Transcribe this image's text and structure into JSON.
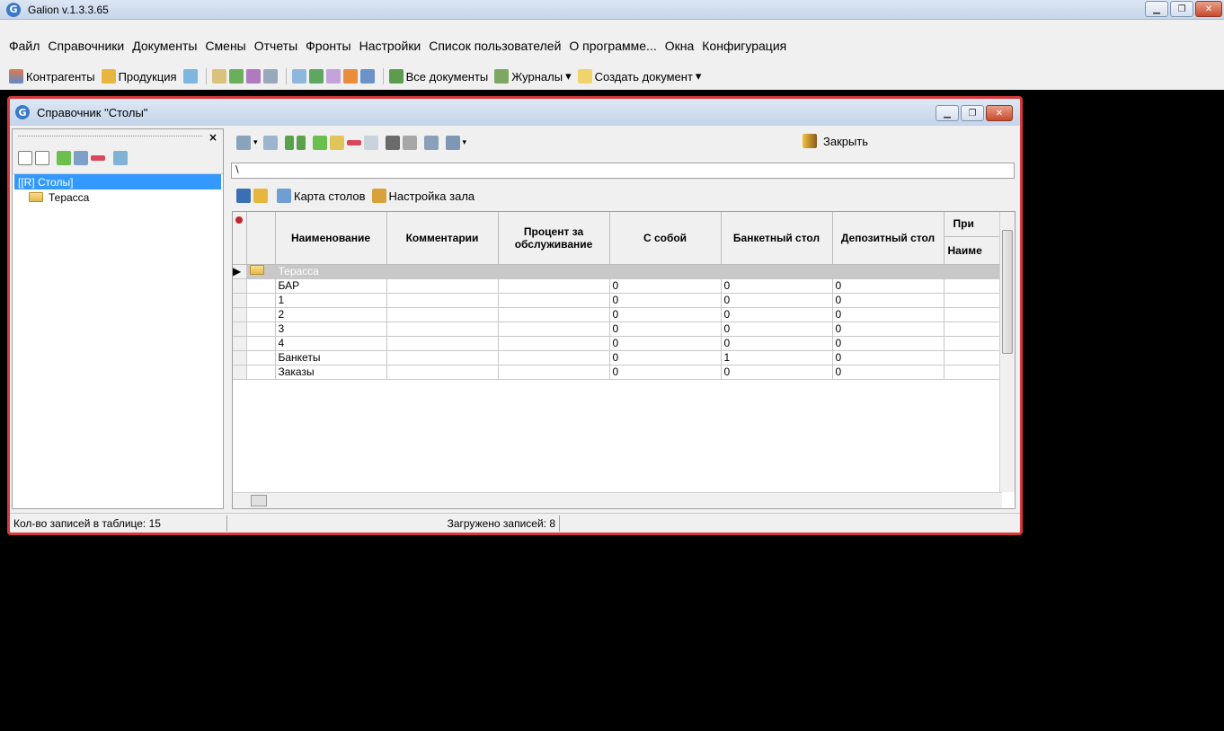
{
  "app": {
    "title": "Galion v.1.3.3.65",
    "logo_glyph": "G"
  },
  "window_buttons": {
    "minimize": "▁",
    "restore": "❐",
    "close": "✕"
  },
  "menu": {
    "items": [
      "Файл",
      "Справочники",
      "Документы",
      "Смены",
      "Отчеты",
      "Фронты",
      "Настройки",
      "Список пользователей",
      "О программе...",
      "Окна",
      "Конфигурация"
    ]
  },
  "toolbar": {
    "contractors": "Контрагенты",
    "products": "Продукция",
    "all_documents": "Все документы",
    "journals": "Журналы",
    "create_document": "Создать документ",
    "dropdown_glyph": "▾"
  },
  "child_window": {
    "title": "Справочник \"Столы\"",
    "close_pane_glyph": "×"
  },
  "tree": {
    "items": [
      {
        "label": "[[R] Столы]",
        "selected": true
      },
      {
        "label": "Терасса",
        "selected": false
      }
    ]
  },
  "grid_toolbar": {
    "close_label": "Закрыть",
    "tables_map": "Карта столов",
    "hall_settings": "Настройка зала",
    "path": "\\"
  },
  "grid": {
    "columns": [
      "Наименование",
      "Комментарии",
      "Процент за обслуживание",
      "С собой",
      "Банкетный стол",
      "Депозитный стол"
    ],
    "extra_column_top": "При",
    "extra_column_bottom": "Наиме",
    "group_row": "Терасса",
    "rows": [
      {
        "name": "БАР",
        "comment": "",
        "service": "",
        "takeaway": "0",
        "banquet": "0",
        "deposit": "0"
      },
      {
        "name": "1",
        "comment": "",
        "service": "",
        "takeaway": "0",
        "banquet": "0",
        "deposit": "0"
      },
      {
        "name": "2",
        "comment": "",
        "service": "",
        "takeaway": "0",
        "banquet": "0",
        "deposit": "0"
      },
      {
        "name": "3",
        "comment": "",
        "service": "",
        "takeaway": "0",
        "banquet": "0",
        "deposit": "0"
      },
      {
        "name": "4",
        "comment": "",
        "service": "",
        "takeaway": "0",
        "banquet": "0",
        "deposit": "0"
      },
      {
        "name": "Банкеты",
        "comment": "",
        "service": "",
        "takeaway": "0",
        "banquet": "1",
        "deposit": "0"
      },
      {
        "name": "Заказы",
        "comment": "",
        "service": "",
        "takeaway": "0",
        "banquet": "0",
        "deposit": "0"
      }
    ]
  },
  "status": {
    "records_in_table": "Кол-во записей в таблице: 15",
    "loaded_records": "Загружено записей: 8"
  },
  "colors": {
    "selection": "#3399ff",
    "highlight_border": "#d8383c",
    "group_row": "#c8c8c8"
  }
}
